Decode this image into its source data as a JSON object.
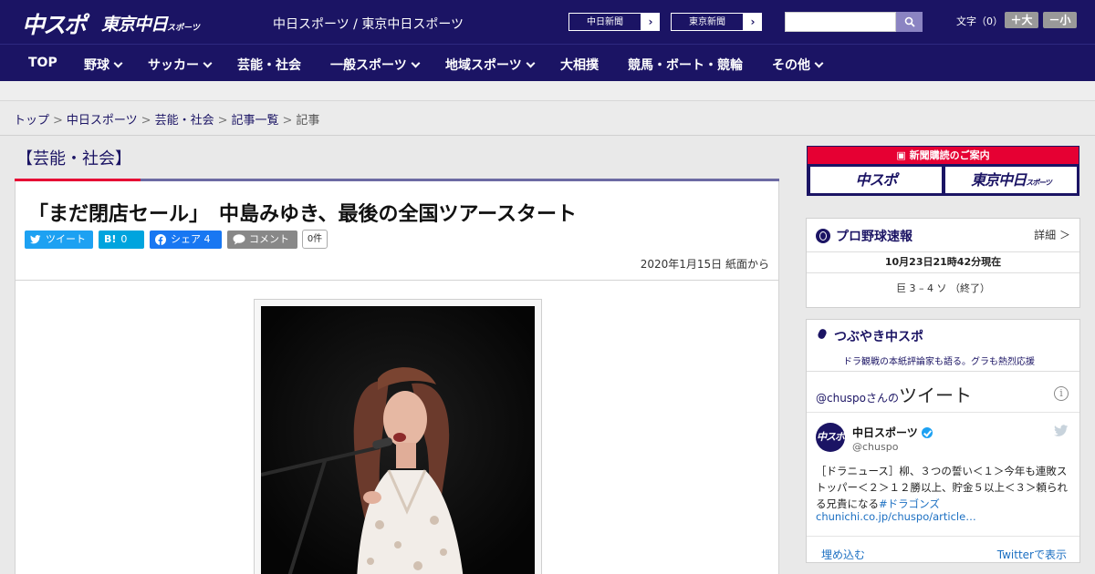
{
  "header": {
    "logo_main": "中スポ",
    "logo_tokyo": "東京中日",
    "logo_tokyo_small": "スポーツ",
    "site_title": "中日スポーツ / 東京中日スポーツ",
    "ext_links": [
      {
        "label": "中日新聞"
      },
      {
        "label": "東京新聞"
      }
    ],
    "search": {
      "placeholder": ""
    },
    "font_size_label": "文字（0）",
    "font_plus": "＋大",
    "font_minus": "－小"
  },
  "nav": {
    "items": [
      {
        "label": "TOP",
        "has_menu": false
      },
      {
        "label": "野球",
        "has_menu": true
      },
      {
        "label": "サッカー",
        "has_menu": true
      },
      {
        "label": "芸能・社会",
        "has_menu": false
      },
      {
        "label": "一般スポーツ",
        "has_menu": true
      },
      {
        "label": "地域スポーツ",
        "has_menu": true
      },
      {
        "label": "大相撲",
        "has_menu": false
      },
      {
        "label": "競馬・ボート・競輪",
        "has_menu": false
      },
      {
        "label": "その他",
        "has_menu": true
      }
    ]
  },
  "breadcrumb": {
    "items": [
      "トップ",
      "中日スポーツ",
      "芸能・社会",
      "記事一覧"
    ],
    "current": "記事"
  },
  "article": {
    "category": "【芸能・社会】",
    "headline": "「まだ閉店セール」　中島みゆき、最後の全国ツアースタート",
    "share": {
      "tweet": "ツイート",
      "hatena_icon": "B!",
      "hatena_count": "0",
      "facebook": "シェア",
      "facebook_count": "4",
      "comment": "コメント",
      "comment_count": "0件"
    },
    "date": "2020年1月15日 紙面から"
  },
  "sidebar": {
    "ad": {
      "title": "新聞購読のご案内",
      "left": "中スポ",
      "right": "東京中日",
      "right_small": "スポーツ"
    },
    "baseball": {
      "title": "プロ野球速報",
      "detail": "詳細 ＞",
      "time": "10月23日21時42分現在",
      "score": "巨 3 – 4 ソ （終了）"
    },
    "tweets": {
      "title": "つぶやき中スポ",
      "subtitle": "ドラ観戦の本紙評論家も語る。グラも熱烈応援",
      "handle_prefix": "@chuspo",
      "handle_suffix": "さんの",
      "header_big": "ツイート",
      "user_name": "中日スポーツ",
      "user_handle": "@chuspo",
      "avatar_text": "中スポ",
      "body": "［ドラニュース］柳、３つの誓い＜１＞今年も連敗ストッパー＜２＞１２勝以上、貯金５以上＜３＞頼られる兄貴になる",
      "hashtag": "#ドラゴンズ",
      "link": "chunichi.co.jp/chuspo/article…",
      "embed_label": "埋め込む",
      "view_label": "Twitterで表示"
    }
  },
  "colors": {
    "brand_navy": "#1b1464",
    "accent_red": "#e60033",
    "twitter": "#1da1f2",
    "hatena": "#00a4de",
    "facebook": "#1877f2"
  }
}
